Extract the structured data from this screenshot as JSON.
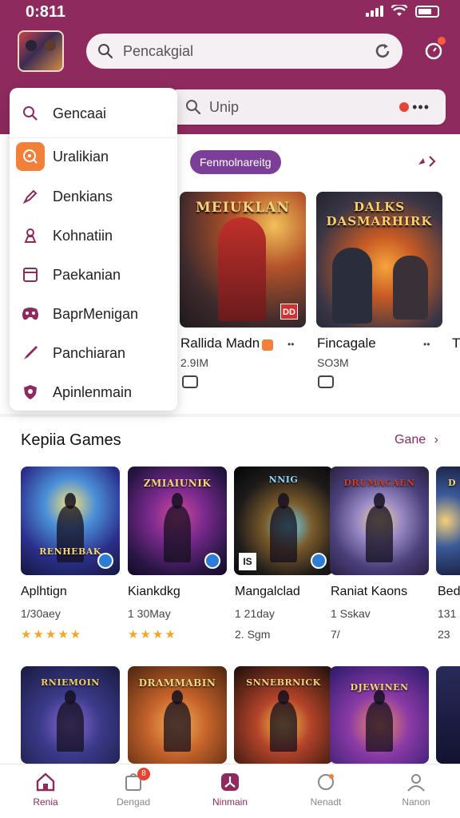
{
  "status": {
    "time": "0:811"
  },
  "header": {
    "search_placeholder": "Pencakgial",
    "sub_search_placeholder": "Unip",
    "sub_search_more": "•••"
  },
  "menu": {
    "items": [
      {
        "label": "Gencaai",
        "icon": "search-icon"
      },
      {
        "label": "Uralikian",
        "icon": "search-zoom-icon"
      },
      {
        "label": "Denkians",
        "icon": "pen-icon"
      },
      {
        "label": "Kohnatiin",
        "icon": "person-icon"
      },
      {
        "label": "Paekanian",
        "icon": "window-icon"
      },
      {
        "label": "BaprMenigan",
        "icon": "gamepad-icon"
      },
      {
        "label": "Panchiaran",
        "icon": "brush-icon"
      },
      {
        "label": "Apinlenmain",
        "icon": "shield-icon"
      }
    ]
  },
  "featured": {
    "pill_label": "Fenmolnareitg",
    "arrow": "›",
    "cards": [
      {
        "art_title": "MEIUKLAN",
        "badge": "DD",
        "name": "Rallida Madn",
        "size": "2.9IM",
        "more": "••"
      },
      {
        "art_title": "DALKS DASMARHIRK",
        "name": "Fincagale",
        "size": "SO3M",
        "more": "••"
      },
      {
        "name": "Ti"
      }
    ]
  },
  "section2": {
    "title": "Kepiia Games",
    "link": "Gane",
    "row1": [
      {
        "art_title": "RENHEBAK",
        "name": "Aplhtign",
        "sub": "1/30aey",
        "stars": "★★★★★"
      },
      {
        "art_title": "ZMIAIUNIK",
        "name": "Kiankdkg",
        "sub": "1 30May",
        "stars": "★★★★"
      },
      {
        "art_title": "NNIG",
        "badge_text": "IS",
        "name": "Mangalclad",
        "sub": "1 21day",
        "sub2": "2. Sgm"
      },
      {
        "art_title": "DRUMACAEN",
        "name": "Raniat Kaons",
        "sub": "1 Sskav",
        "sub2": "7/"
      },
      {
        "art_title": "D",
        "name": "Bed",
        "sub": "131",
        "sub2": "23"
      }
    ],
    "row2": [
      {
        "art_title": "RNIEMOIN"
      },
      {
        "art_title": "DRAMMABIN"
      },
      {
        "art_title": "SNNEBRNICK"
      },
      {
        "art_title": "DJEWINEN"
      }
    ]
  },
  "nav": {
    "items": [
      {
        "label": "Renia",
        "icon": "home-icon",
        "active": true
      },
      {
        "label": "Dengad",
        "icon": "bag-icon",
        "badge": "8"
      },
      {
        "label": "Ninmain",
        "icon": "compass-icon",
        "active": true
      },
      {
        "label": "Nenadt",
        "icon": "chat-icon"
      },
      {
        "label": "Nanon",
        "icon": "profile-icon"
      }
    ]
  },
  "colors": {
    "brand": "#8e2a5e",
    "accent": "#7b3f98",
    "orange": "#f2803b",
    "star": "#f5a623"
  }
}
